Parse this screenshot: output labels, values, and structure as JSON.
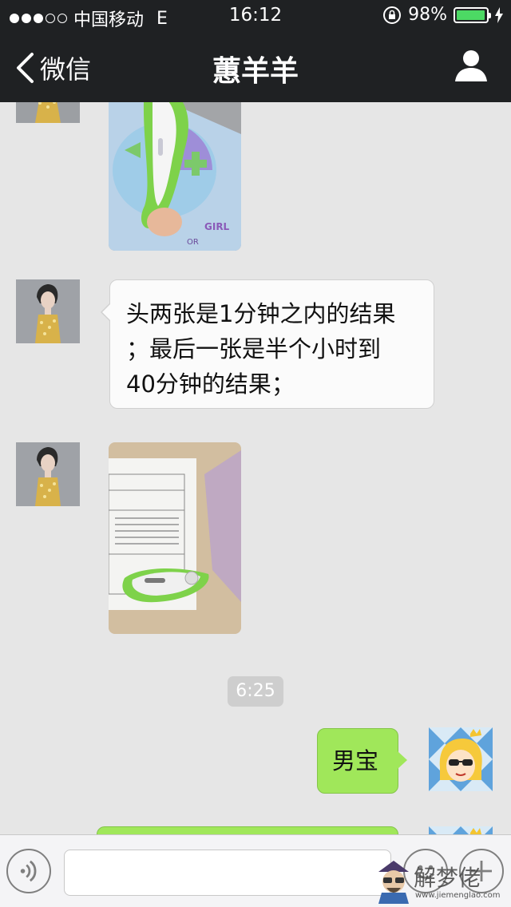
{
  "status_bar": {
    "signal_dots_filled": 3,
    "signal_dots_total": 5,
    "carrier": "中国移动",
    "network": "E",
    "time": "16:12",
    "battery_percent": "98%",
    "battery_level": 0.98,
    "icons": [
      "rotation-lock-icon",
      "battery-icon",
      "charging-bolt-icon"
    ]
  },
  "nav": {
    "back_label": "微信",
    "title": "蕙羊羊",
    "right_icon": "person-icon"
  },
  "messages": [
    {
      "type": "image",
      "sender": "other",
      "description_icon": "gender-predictor-photo"
    },
    {
      "type": "text",
      "sender": "other",
      "lines": [
        "头两张是1分钟之内的结果",
        "；最后一张是半个小时到",
        "40分钟的结果；"
      ]
    },
    {
      "type": "image",
      "sender": "other",
      "description_icon": "instructions-sheet-photo"
    },
    {
      "type": "timestamp",
      "text": "6:25"
    },
    {
      "type": "text",
      "sender": "me",
      "lines": [
        "男宝"
      ]
    },
    {
      "type": "text",
      "sender": "me",
      "lines": [
        ""
      ]
    }
  ],
  "input_bar": {
    "voice_icon": "voice-icon",
    "emoji_icon": "emoji-icon",
    "plus_icon": "plus-icon",
    "input_value": ""
  },
  "watermark": {
    "text": "解梦佬",
    "url": "www.jiemenglao.com"
  },
  "colors": {
    "bar_bg": "#1f2123",
    "chat_bg": "#e6e6e6",
    "bubble_out": "#a0e75a",
    "bubble_in": "#fbfbfb",
    "battery_fill": "#4cd964"
  }
}
